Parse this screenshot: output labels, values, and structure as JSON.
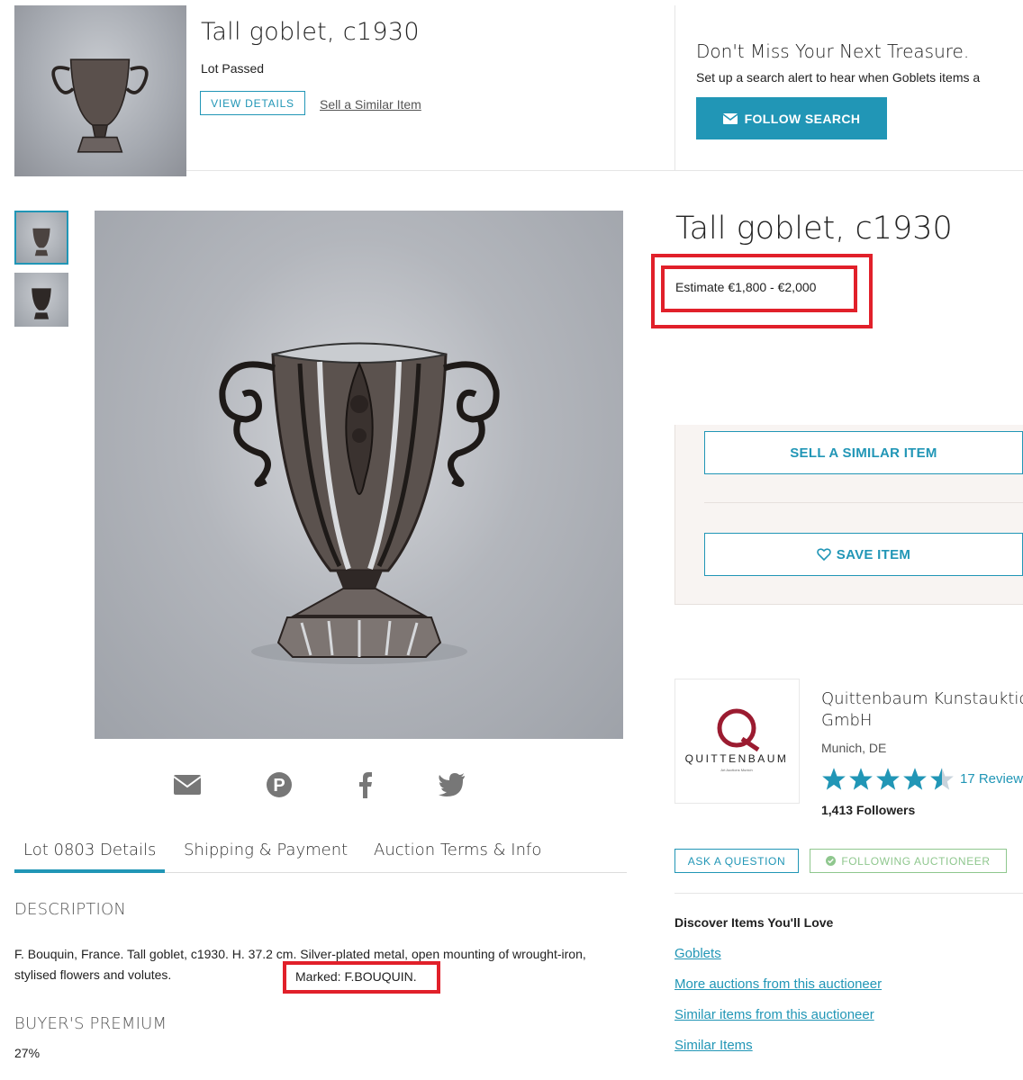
{
  "banner": {
    "title": "Tall goblet, c1930",
    "status": "Lot Passed",
    "view_details": "VIEW DETAILS",
    "sell_similar": "Sell a Similar Item",
    "alert_title": "Don't Miss Your Next Treasure.",
    "alert_sub": "Set up a search alert to hear when Goblets items a",
    "follow_search": "FOLLOW SEARCH"
  },
  "item": {
    "title": "Tall goblet, c1930",
    "estimate": "Estimate €1,800 - €2,000"
  },
  "actions": {
    "sell_similar": "SELL A SIMILAR ITEM",
    "save_item": "SAVE ITEM"
  },
  "auctioneer": {
    "name_line1": "Quittenbaum Kunstauktion",
    "name_line2": "GmbH",
    "location": "Munich, DE",
    "rating": 4.5,
    "reviews": "17 Review",
    "followers": "1,413 Followers",
    "logo_text": "QUITTENBAUM",
    "logo_letter": "Q",
    "logo_tagline": "Art Auctions Munich",
    "ask_question": "ASK A QUESTION",
    "following": "FOLLOWING AUCTIONEER"
  },
  "tabs": [
    {
      "label": "Lot 0803 Details"
    },
    {
      "label": "Shipping & Payment"
    },
    {
      "label": "Auction Terms & Info"
    }
  ],
  "details": {
    "description_heading": "DESCRIPTION",
    "description_text": "F. Bouquin, France. Tall goblet, c1930. H. 37.2 cm. Silver-plated metal, open mounting of wrought-iron, stylised flowers and volutes.",
    "marked": "Marked: F.BOUQUIN.",
    "premium_heading": "BUYER'S PREMIUM",
    "premium_value": "27%"
  },
  "discover": {
    "heading": "Discover Items You'll Love",
    "links": [
      "Goblets",
      "More auctions from this auctioneer",
      "Similar items from this auctioneer",
      "Similar Items"
    ]
  },
  "colors": {
    "accent": "#2196b6",
    "highlight": "#e1202a",
    "following": "#8fc78e",
    "logo": "#9b1b30"
  }
}
